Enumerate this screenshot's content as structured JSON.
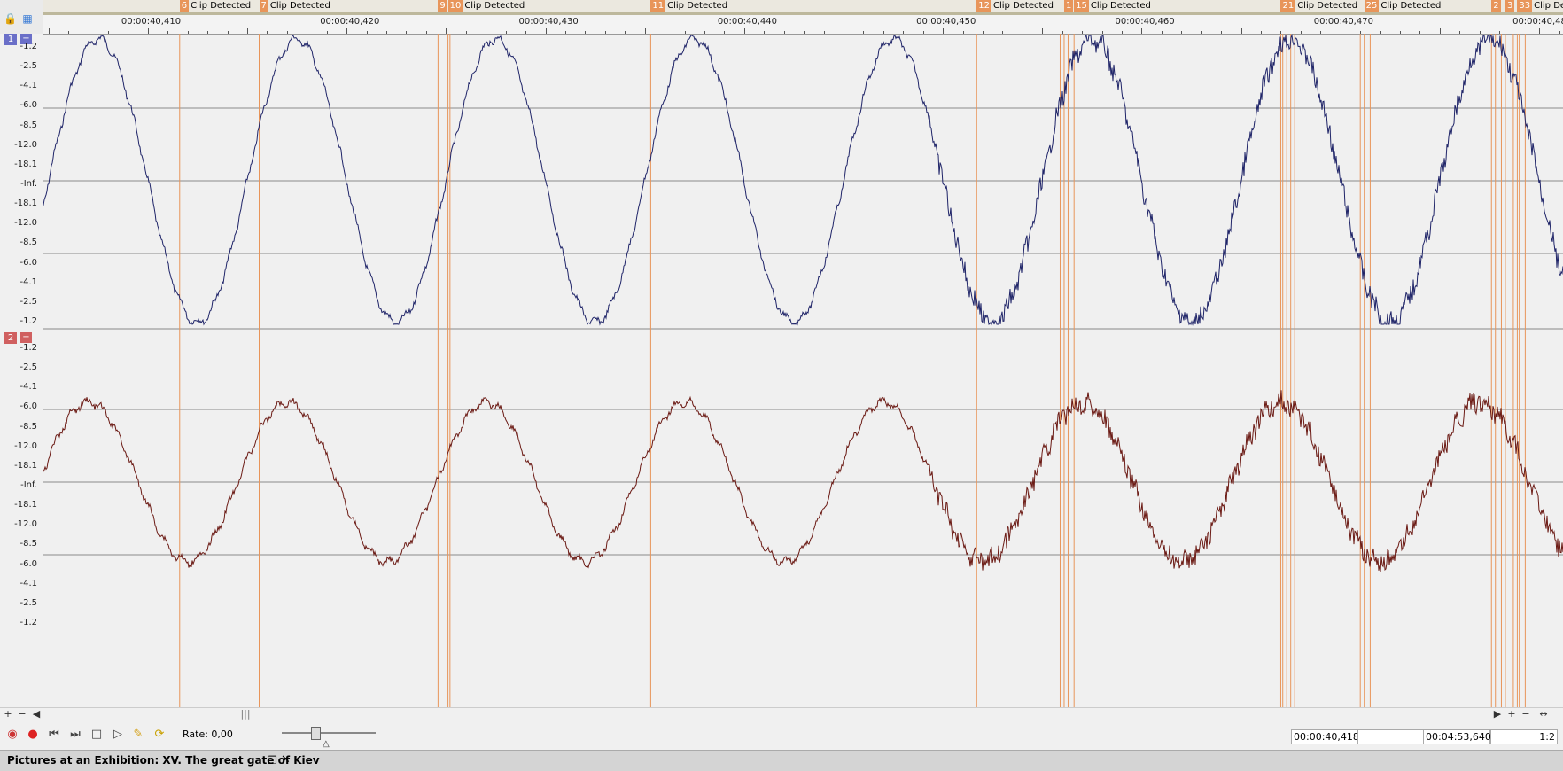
{
  "markers": [
    {
      "id": "6",
      "label": "Clip Detected",
      "time": 40.4116
    },
    {
      "id": "7",
      "label": "Clip Detected",
      "time": 40.4156
    },
    {
      "id": "9",
      "label": "",
      "time": 40.4246
    },
    {
      "id": "10",
      "label": "Clip Detected",
      "time": 40.4251
    },
    {
      "id": "11",
      "label": "Clip Detected",
      "time": 40.4353
    },
    {
      "id": "12",
      "label": "Clip Detected",
      "time": 40.4517
    },
    {
      "id": "1",
      "label": "",
      "time": 40.4561
    },
    {
      "id": "15",
      "label": "Clip Detected",
      "time": 40.4566
    },
    {
      "id": "21",
      "label": "Clip Detected",
      "time": 40.467
    },
    {
      "id": "25",
      "label": "Clip Detected",
      "time": 40.4712
    },
    {
      "id": "2",
      "label": "",
      "time": 40.4776
    },
    {
      "id": "3",
      "label": "",
      "time": 40.4783
    },
    {
      "id": "33",
      "label": "Clip Detected",
      "time": 40.4789
    }
  ],
  "extra_marker_times": [
    40.4252,
    40.4559,
    40.4563,
    40.4671,
    40.4673,
    40.4675,
    40.4677,
    40.471,
    40.4715,
    40.4778,
    40.4781,
    40.4787,
    40.479,
    40.4793
  ],
  "ruler": {
    "labels": [
      "00:00:40,410",
      "00:00:40,420",
      "00:00:40,430",
      "00:00:40,440",
      "00:00:40,450",
      "00:00:40,460",
      "00:00:40,470",
      "00:00:40,480"
    ],
    "view_start": 40.4047,
    "view_end": 40.4812
  },
  "channels": [
    {
      "number": "1",
      "badge_color": "#6a6fc8",
      "wave_color": "#1f2468",
      "collapse_label": "−"
    },
    {
      "number": "2",
      "badge_color": "#d06060",
      "wave_color": "#6b1a14",
      "collapse_label": "−"
    }
  ],
  "db_scale": [
    "-1.2",
    "-2.5",
    "-4.1",
    "-6.0",
    "-8.5",
    "-12.0",
    "-18.1",
    "-Inf.",
    "-18.1",
    "-12.0",
    "-8.5",
    "-6.0",
    "-4.1",
    "-2.5",
    "-1.2"
  ],
  "transport": {
    "rate_label": "Rate: 0,00",
    "cursor_time": "00:00:40,418",
    "selection_field": "",
    "length_field": "00:04:53,640",
    "zoom_ratio": "1:2"
  },
  "status": {
    "document_title": "Pictures at an Exhibition: XV. The great gate of Kiev"
  },
  "icons": {
    "lock": "lock-icon",
    "snap": "snap-icon",
    "record_arm": "record-arm-icon",
    "record": "record-icon",
    "go_start": "go-to-start-icon",
    "go_end": "go-to-end-icon",
    "stop": "stop-icon",
    "play": "play-icon",
    "auto_scroll": "auto-scroll-icon",
    "loop": "loop-icon",
    "restore": "restore-icon",
    "close": "close-icon"
  }
}
